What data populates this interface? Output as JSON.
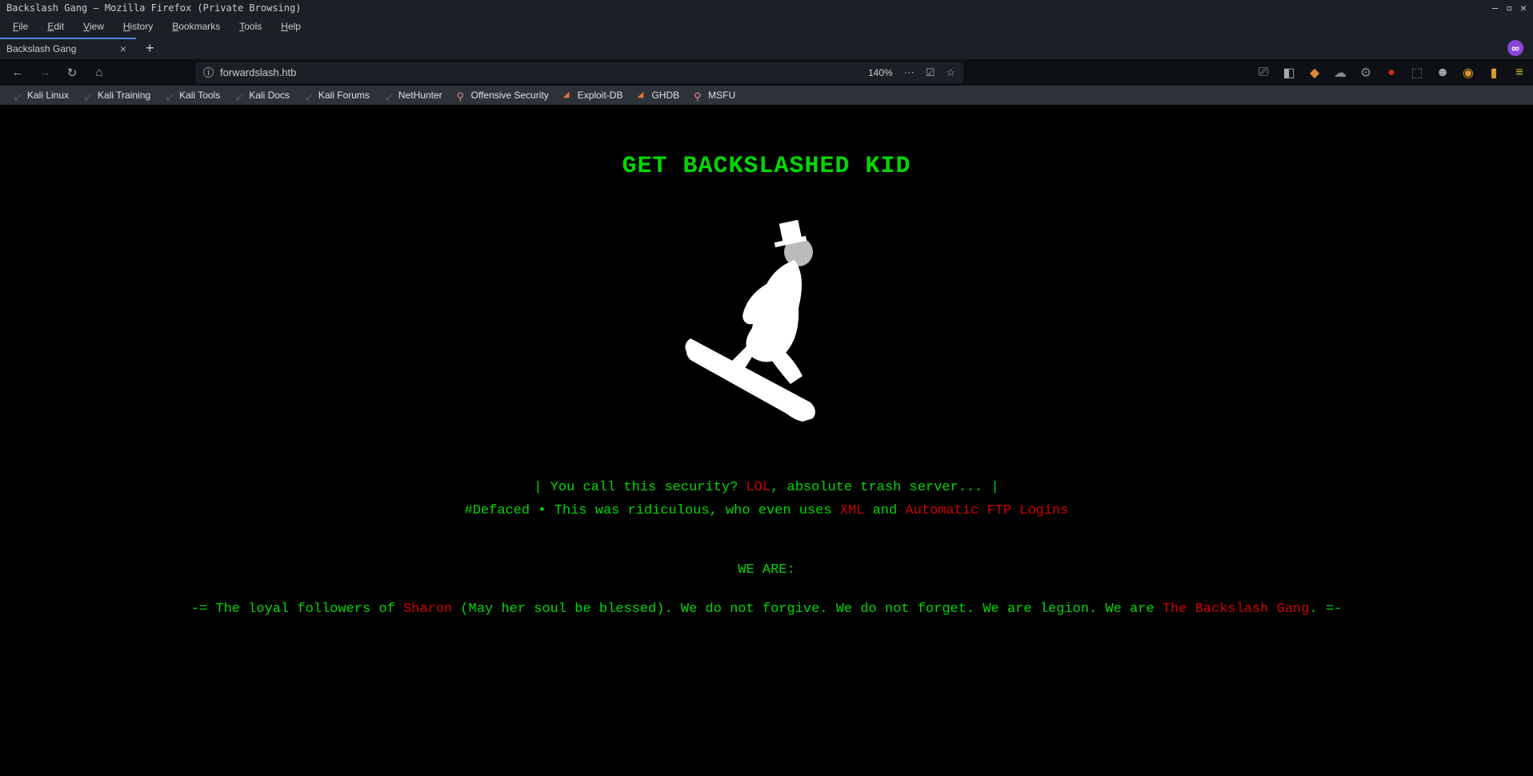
{
  "window": {
    "title": "Backslash Gang – Mozilla Firefox (Private Browsing)"
  },
  "menu": {
    "file": "File",
    "edit": "Edit",
    "view": "View",
    "history": "History",
    "bookmarks": "Bookmarks",
    "tools": "Tools",
    "help": "Help"
  },
  "tab": {
    "title": "Backslash Gang"
  },
  "url": {
    "text": "forwardslash.htb",
    "zoom": "140%"
  },
  "bookmarks": {
    "b0": "Kali Linux",
    "b1": "Kali Training",
    "b2": "Kali Tools",
    "b3": "Kali Docs",
    "b4": "Kali Forums",
    "b5": "NetHunter",
    "b6": "Offensive Security",
    "b7": "Exploit-DB",
    "b8": "GHDB",
    "b9": "MSFU"
  },
  "page": {
    "headline": "GET BACKSLASHED KID",
    "line1_a": "|  You call this security? ",
    "line1_lol": "LOL",
    "line1_b": ", absolute trash server...  |",
    "line2_a": "#Defaced • This was ridiculous, who even uses ",
    "line2_xml": "XML",
    "line2_and": " and ",
    "line2_ftp": "Automatic FTP Logins",
    "weare": "WE ARE:",
    "final_a": "-= The loyal followers of ",
    "final_sharon": "Sharon",
    "final_b": " (May her soul be blessed). We do not forgive. We do not forget. We are legion. We are ",
    "final_gang": "The Backslash Gang",
    "final_c": ". =-"
  }
}
